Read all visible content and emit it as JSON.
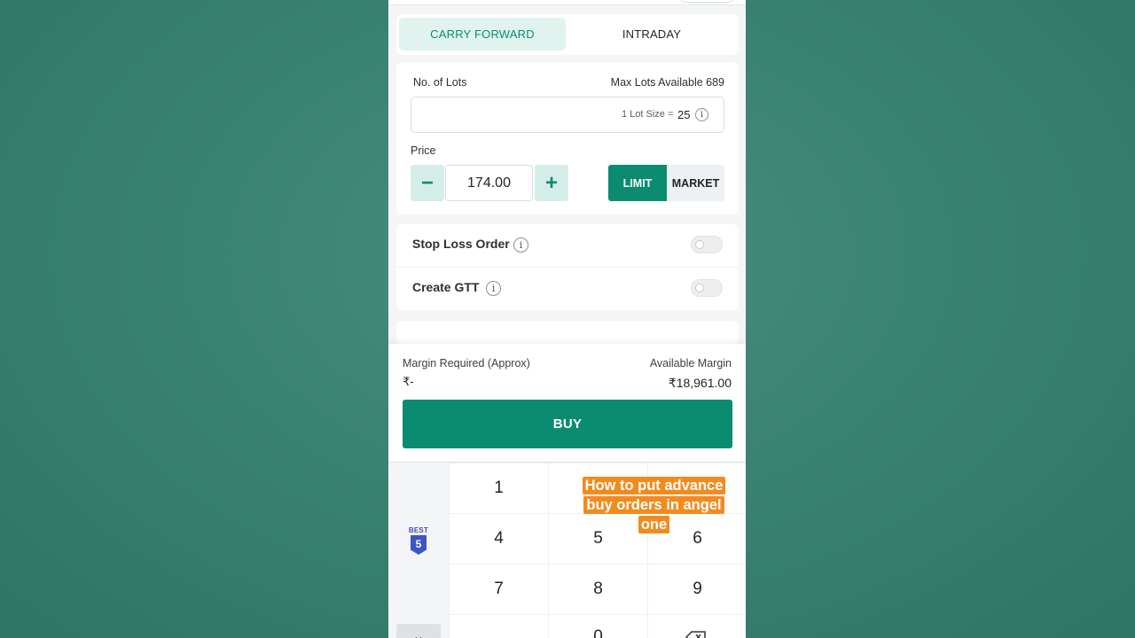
{
  "tabs": {
    "carry_forward": "CARRY FORWARD",
    "intraday": "INTRADAY"
  },
  "lots": {
    "label": "No. of Lots",
    "max_available": "Max Lots Available 689",
    "lot_size_label": "1 Lot Size =",
    "lot_size_value": "25",
    "info_glyph": "i"
  },
  "price": {
    "label": "Price",
    "value": "174.00",
    "minus": "−",
    "plus": "+",
    "limit_label": "LIMIT",
    "market_label": "MARKET"
  },
  "toggles": {
    "stop_loss": {
      "label": "Stop Loss Order",
      "enabled": false
    },
    "create_gtt": {
      "label": "Create GTT",
      "enabled": false
    },
    "info_glyph": "i"
  },
  "margin": {
    "required_label": "Margin Required (Approx)",
    "required_value": "₹-",
    "available_label": "Available Margin",
    "available_value": "₹18,961.00"
  },
  "buy_label": "BUY",
  "keypad": {
    "keys": [
      "1",
      "4",
      "5",
      "6",
      "7",
      "8",
      "9",
      "0"
    ],
    "close_glyph": "⌄"
  },
  "keyboard_badge": {
    "top": "BEST",
    "number": "5"
  },
  "overlay_caption": "How to put advance buy orders in angel one",
  "colors": {
    "accent": "#0b8c70",
    "accent_light": "#e1f3ef",
    "caption_bg": "#f28b1e"
  }
}
